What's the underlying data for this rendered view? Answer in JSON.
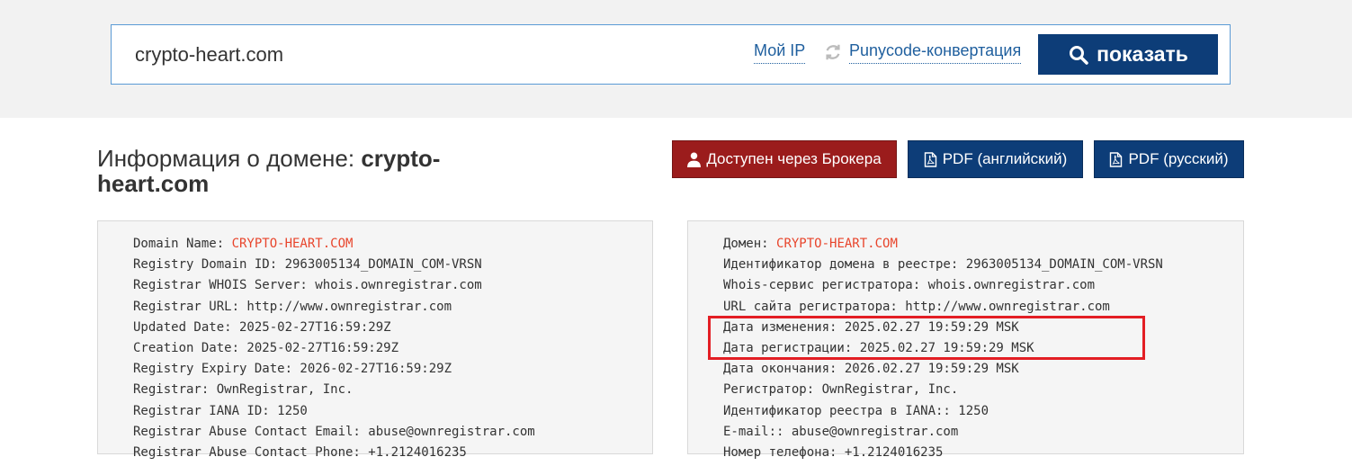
{
  "search": {
    "value": "crypto-heart.com",
    "my_ip_label": "Мой IP",
    "punycode_label": "Punycode-конвертация",
    "show_label": "показать"
  },
  "title": {
    "prefix": "Информация о домене: ",
    "domain": "crypto-heart.com"
  },
  "actions": {
    "broker_label": "Доступен через Брокера",
    "pdf_en_label": "PDF (английский)",
    "pdf_ru_label": "PDF (русский)"
  },
  "whois_en": [
    {
      "label": "Domain Name: ",
      "value": "CRYPTO-HEART.COM"
    },
    {
      "label": "Registry Domain ID: 2963005134_DOMAIN_COM-VRSN"
    },
    {
      "label": "Registrar WHOIS Server: whois.ownregistrar.com"
    },
    {
      "label": "Registrar URL: http://www.ownregistrar.com"
    },
    {
      "label": "Updated Date: 2025-02-27T16:59:29Z"
    },
    {
      "label": "Creation Date: 2025-02-27T16:59:29Z"
    },
    {
      "label": "Registry Expiry Date: 2026-02-27T16:59:29Z"
    },
    {
      "label": "Registrar: OwnRegistrar, Inc."
    },
    {
      "label": "Registrar IANA ID: 1250"
    },
    {
      "label": "Registrar Abuse Contact Email: abuse@ownregistrar.com"
    },
    {
      "label": "Registrar Abuse Contact Phone: +1.2124016235"
    }
  ],
  "whois_ru": [
    {
      "label": "Домен: ",
      "value": "CRYPTO-HEART.COM"
    },
    {
      "label": "Идентификатор домена в реестре: 2963005134_DOMAIN_COM-VRSN"
    },
    {
      "label": "Whois-сервис регистратора: whois.ownregistrar.com"
    },
    {
      "label": "URL сайта регистратора: http://www.ownregistrar.com"
    },
    {
      "label": "Дата изменения: 2025.02.27 19:59:29 MSK"
    },
    {
      "label": "Дата регистрации: 2025.02.27 19:59:29 MSK"
    },
    {
      "label": "Дата окончания: 2026.02.27 19:59:29 MSK"
    },
    {
      "label": "Регистратор: OwnRegistrar, Inc."
    },
    {
      "label": "Идентификатор реестра в IANA:: 1250"
    },
    {
      "label": "E-mail:: abuse@ownregistrar.com"
    },
    {
      "label": "Номер телефона: +1.2124016235"
    }
  ],
  "colors": {
    "accent_blue": "#0d3d78",
    "broker_red": "#9b1c1c",
    "value_orange": "#e8452c",
    "highlight_red": "#e31e24"
  }
}
